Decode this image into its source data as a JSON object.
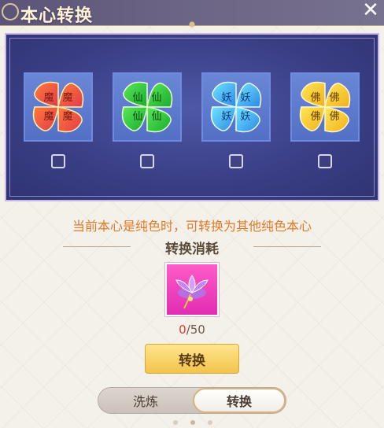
{
  "window": {
    "title": "本心转换",
    "close_icon": "close-icon"
  },
  "options": [
    {
      "char": "魔",
      "element": "demon",
      "palette": [
        "#ff6a3a",
        "#e63d4d"
      ],
      "checked": false
    },
    {
      "char": "仙",
      "element": "immortal",
      "palette": [
        "#4fe04a",
        "#17b02f"
      ],
      "checked": false
    },
    {
      "char": "妖",
      "element": "yao",
      "palette": [
        "#68e0ff",
        "#2f8fe8"
      ],
      "checked": false
    },
    {
      "char": "佛",
      "element": "buddha",
      "palette": [
        "#ffe24a",
        "#f0b51c"
      ],
      "checked": false
    }
  ],
  "hint_text": "当前本心是纯色时，可转换为其他纯色本心",
  "cost": {
    "title": "转换消耗",
    "item_icon": "lotus-icon",
    "current": "0",
    "separator": "/",
    "required": "50"
  },
  "convert_button": "转换",
  "tabs": [
    {
      "label": "洗炼",
      "active": false
    },
    {
      "label": "转换",
      "active": true
    }
  ],
  "colors": {
    "hint": "#e07b27",
    "button": "#f2c44b",
    "arena": "#3a3f86"
  }
}
